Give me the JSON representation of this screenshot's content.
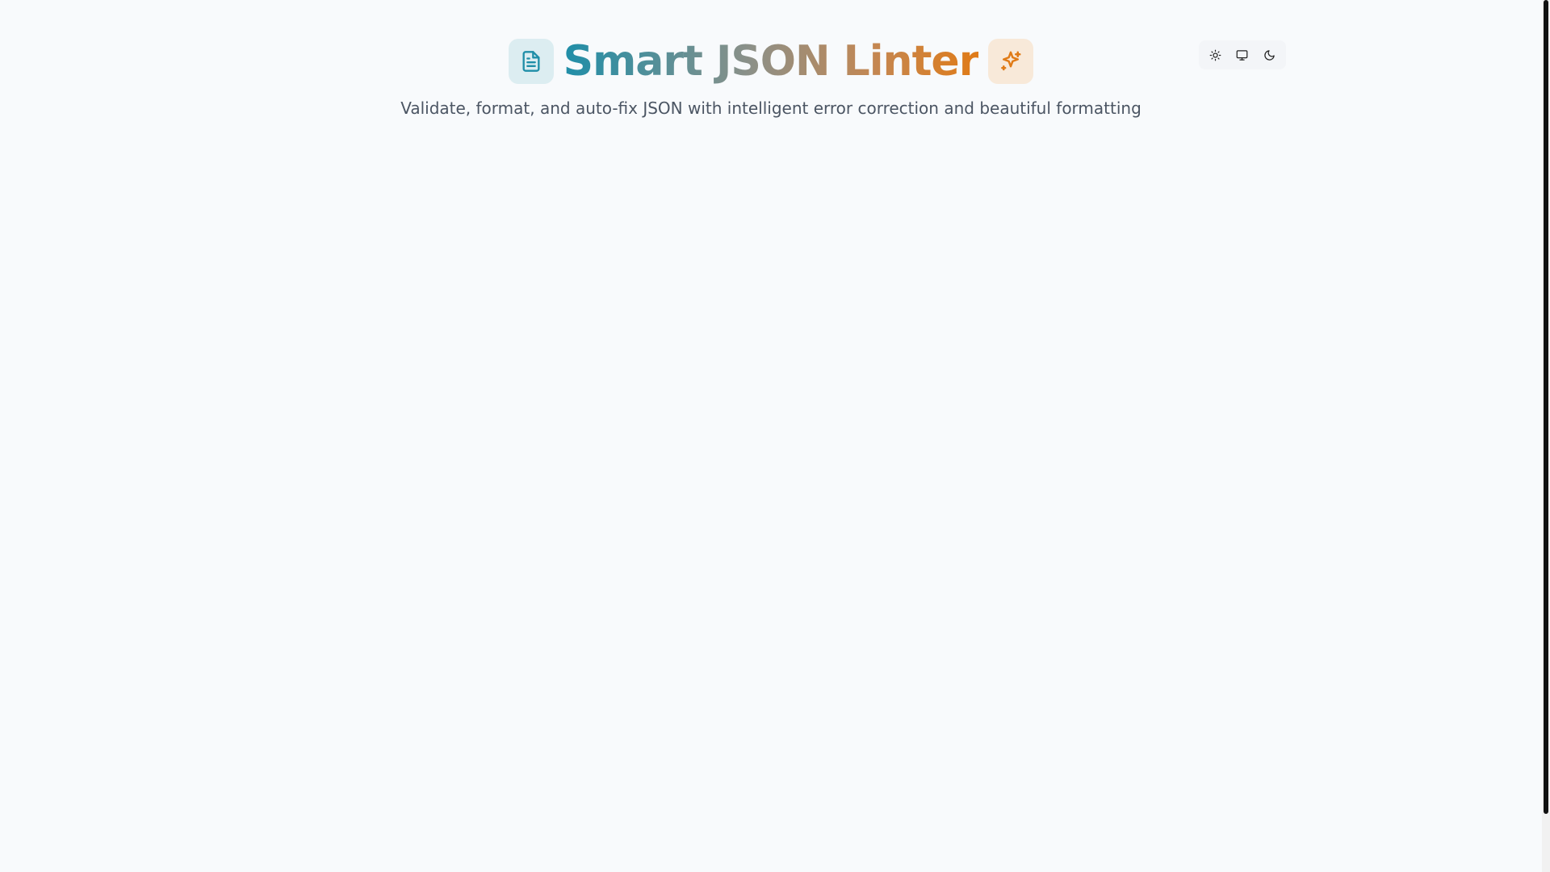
{
  "header": {
    "title": "Smart JSON Linter",
    "subtitle": "Validate, format, and auto-fix JSON with intelligent error correction and beautiful formatting",
    "left_icon": "file-text-icon",
    "right_icon": "sparkles-icon"
  },
  "theme_switcher": {
    "options": [
      {
        "icon": "sun-icon"
      },
      {
        "icon": "monitor-icon"
      },
      {
        "icon": "moon-icon"
      }
    ]
  },
  "colors": {
    "background": "#f8fafc",
    "gradient_start": "#1f8ea8",
    "gradient_end": "#e07b17",
    "subtitle": "#4b5563"
  }
}
